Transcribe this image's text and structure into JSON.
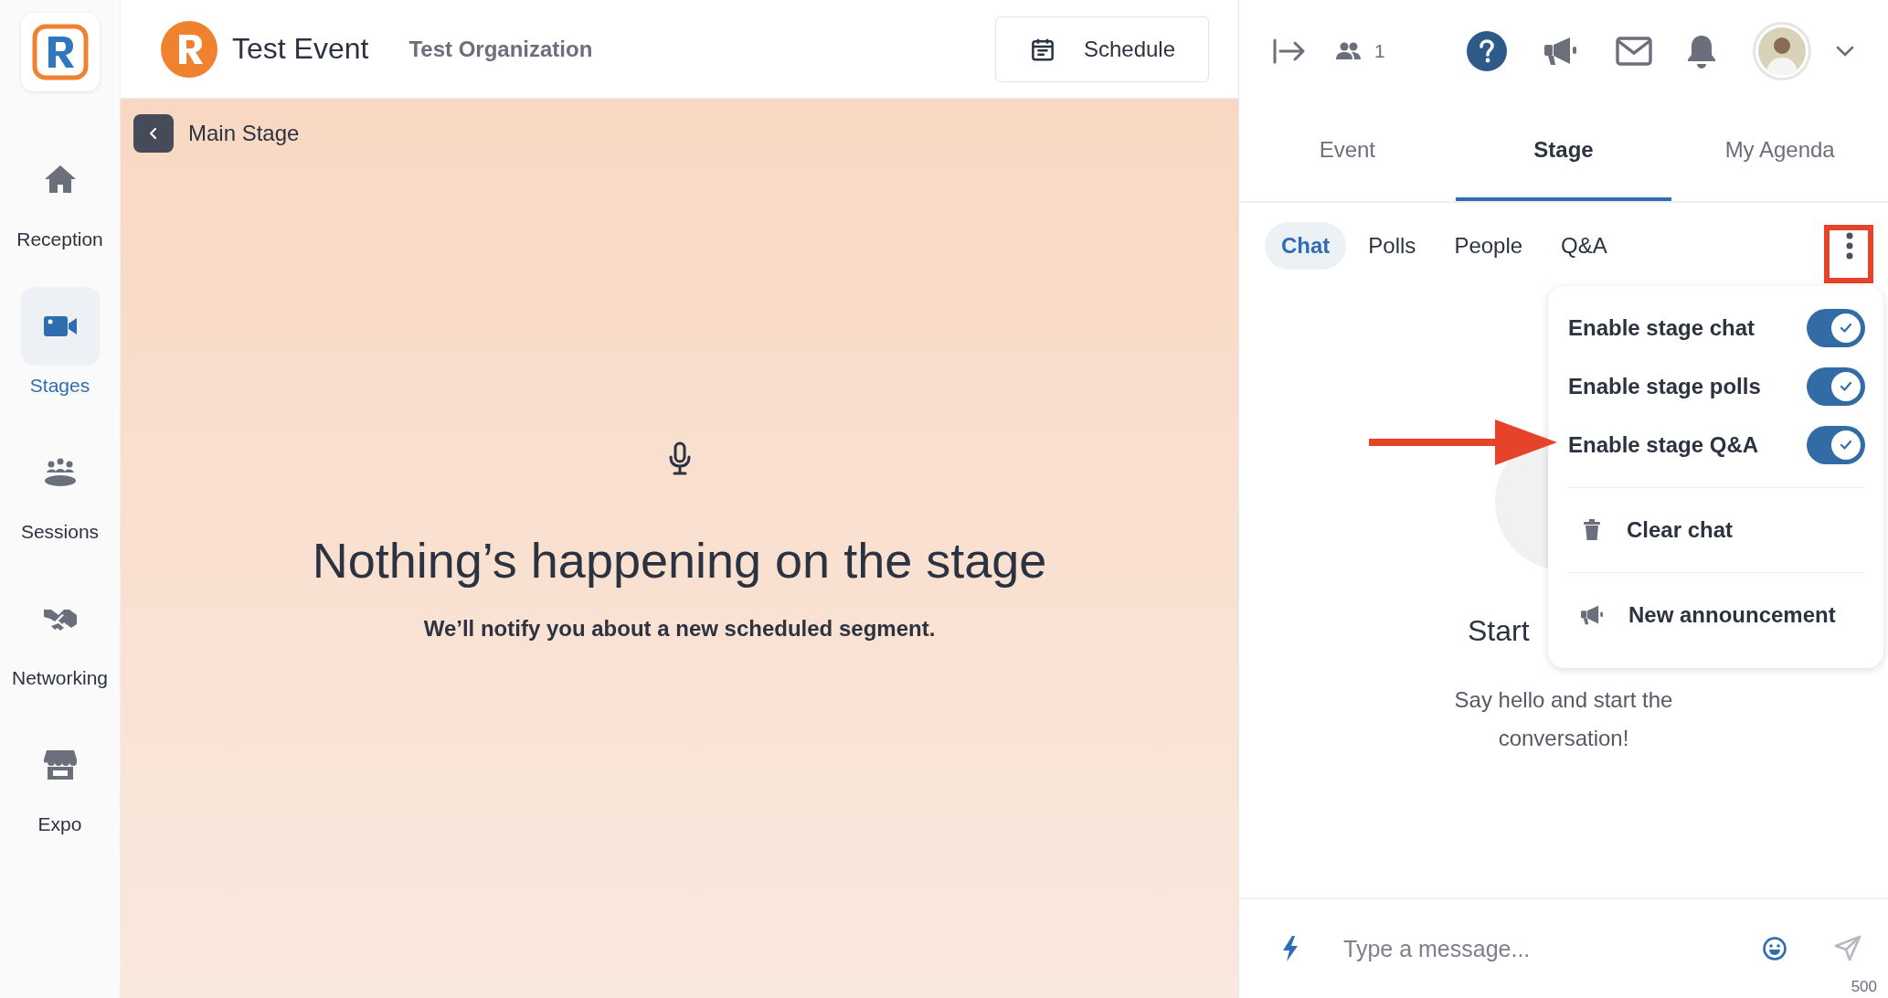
{
  "sidebar": {
    "items": [
      {
        "label": "Reception",
        "selected": false
      },
      {
        "label": "Stages",
        "selected": true
      },
      {
        "label": "Sessions",
        "selected": false
      },
      {
        "label": "Networking",
        "selected": false
      },
      {
        "label": "Expo",
        "selected": false
      }
    ]
  },
  "header": {
    "event_title": "Test Event",
    "organization": "Test Organization",
    "schedule_button": "Schedule"
  },
  "stage": {
    "back_label": "Main Stage",
    "heading": "Nothing’s happening on the stage",
    "subtext": "We’ll notify you about a new scheduled segment."
  },
  "panel": {
    "attendee_count": "1",
    "tabs": [
      {
        "label": "Event",
        "selected": false
      },
      {
        "label": "Stage",
        "selected": true
      },
      {
        "label": "My Agenda",
        "selected": false
      }
    ],
    "subtabs": [
      {
        "label": "Chat",
        "selected": true
      },
      {
        "label": "Polls",
        "selected": false
      },
      {
        "label": "People",
        "selected": false
      },
      {
        "label": "Q&A",
        "selected": false
      }
    ],
    "empty_state": {
      "title": "Start",
      "text": "Say hello and start the conversation!"
    },
    "menu": {
      "items": [
        {
          "kind": "toggle",
          "label": "Enable stage chat",
          "on": true
        },
        {
          "kind": "toggle",
          "label": "Enable stage polls",
          "on": true
        },
        {
          "kind": "toggle",
          "label": "Enable stage Q&A",
          "on": true
        },
        {
          "kind": "delete",
          "label": "Clear chat"
        },
        {
          "kind": "announce",
          "label": "New announcement"
        }
      ]
    },
    "composer": {
      "placeholder": "Type a message...",
      "char_limit": "500"
    }
  }
}
